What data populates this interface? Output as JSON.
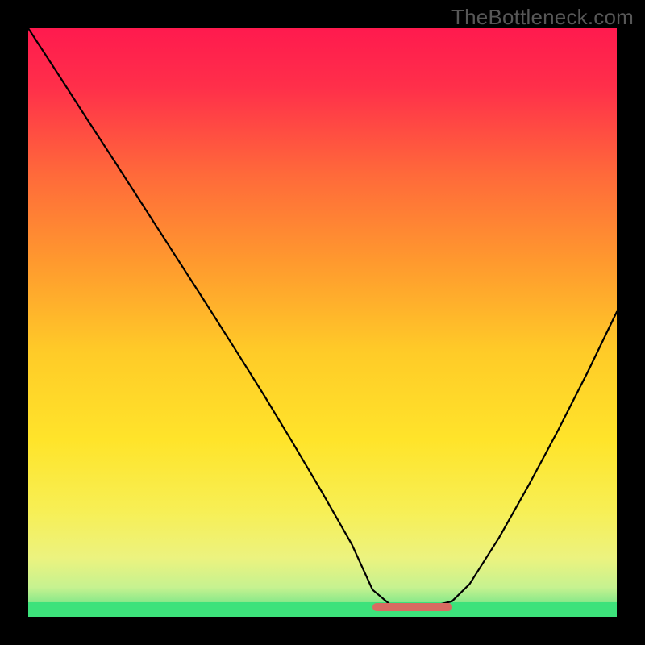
{
  "watermark": "TheBottleneck.com",
  "colors": {
    "frame": "#000000",
    "curve": "#000000",
    "green_band": "#3DE27B",
    "red_mark": "#d96b61",
    "gradient_stops": [
      {
        "offset": 0.0,
        "color": "#ff1a4e"
      },
      {
        "offset": 0.1,
        "color": "#ff2f4a"
      },
      {
        "offset": 0.25,
        "color": "#ff6a3a"
      },
      {
        "offset": 0.4,
        "color": "#ff9a2e"
      },
      {
        "offset": 0.55,
        "color": "#ffcb28"
      },
      {
        "offset": 0.7,
        "color": "#ffe42a"
      },
      {
        "offset": 0.82,
        "color": "#f7ef55"
      },
      {
        "offset": 0.9,
        "color": "#ecf37f"
      },
      {
        "offset": 0.95,
        "color": "#c6f290"
      },
      {
        "offset": 0.975,
        "color": "#8ae98a"
      },
      {
        "offset": 1.0,
        "color": "#3de27b"
      }
    ]
  },
  "chart_data": {
    "type": "line",
    "title": "",
    "xlabel": "",
    "ylabel": "",
    "xlim": [
      0,
      1
    ],
    "ylim": [
      0,
      1
    ],
    "series": [
      {
        "name": "bottleneck-curve",
        "x": [
          0.0,
          0.05,
          0.1,
          0.15,
          0.2,
          0.25,
          0.3,
          0.35,
          0.4,
          0.45,
          0.5,
          0.55,
          0.585,
          0.62,
          0.68,
          0.72,
          0.75,
          0.8,
          0.85,
          0.9,
          0.95,
          1.0
        ],
        "y": [
          1.0,
          0.922,
          0.843,
          0.765,
          0.686,
          0.607,
          0.528,
          0.448,
          0.367,
          0.283,
          0.197,
          0.108,
          0.03,
          0.0,
          0.0,
          0.01,
          0.04,
          0.12,
          0.21,
          0.305,
          0.405,
          0.51
        ]
      }
    ],
    "annotations": [
      {
        "name": "optimal-range-marker",
        "x_start": 0.585,
        "x_end": 0.72,
        "y": 0.0
      }
    ]
  }
}
